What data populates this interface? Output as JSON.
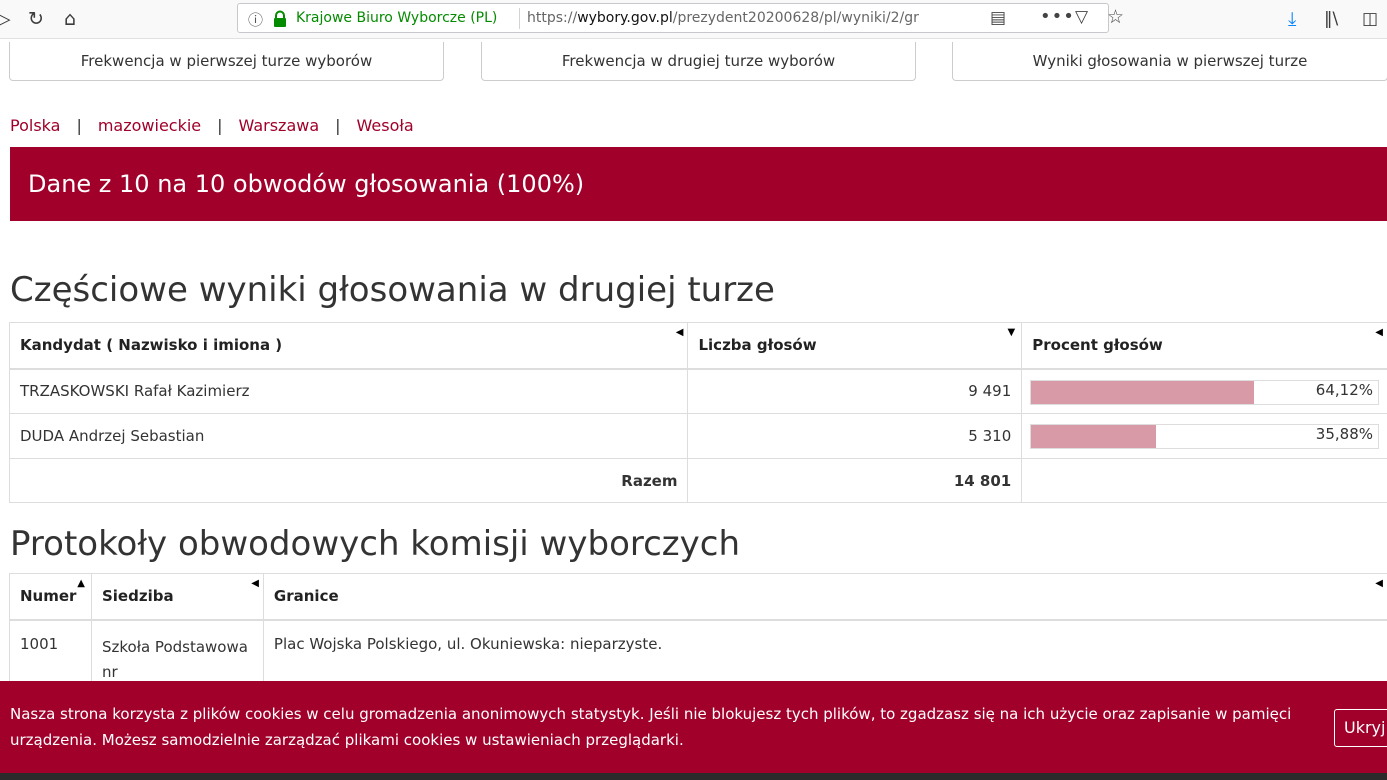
{
  "browser": {
    "url_org": "Krajowe Biuro Wyborcze (PL)",
    "url_prefix": "https://",
    "url_domain": "wybory.gov.pl",
    "url_path": "/prezydent20200628/pl/wyniki/2/gr"
  },
  "top_tabs": [
    "Frekwencja w pierwszej turze wyborów",
    "Frekwencja w drugiej turze wyborów",
    "Wyniki głosowania w pierwszej turze"
  ],
  "breadcrumb": [
    "Polska",
    "mazowieckie",
    "Warszawa",
    "Wesoła"
  ],
  "banner": "Dane z 10 na 10 obwodów głosowania (100%)",
  "results": {
    "heading": "Częściowe wyniki głosowania w drugiej turze",
    "columns": [
      "Kandydat ( Nazwisko i imiona )",
      "Liczba głosów",
      "Procent głosów"
    ],
    "rows": [
      {
        "name": "TRZASKOWSKI Rafał Kazimierz",
        "votes": "9 491",
        "percent": "64,12%",
        "fraction": 0.6412
      },
      {
        "name": "DUDA Andrzej Sebastian",
        "votes": "5 310",
        "percent": "35,88%",
        "fraction": 0.3588
      }
    ],
    "total_label": "Razem",
    "total_votes": "14 801"
  },
  "protocols": {
    "heading": "Protokoły obwodowych komisji wyborczych",
    "columns": [
      "Numer",
      "Siedziba",
      "Granice"
    ],
    "rows": [
      {
        "numer": "1001",
        "siedziba": "Szkoła Podstawowa nr",
        "granice": "Plac Wojska Polskiego, ul. Okuniewska: nieparzyste."
      }
    ]
  },
  "cookie": {
    "text": "Nasza strona korzysta z plików cookies w celu gromadzenia anonimowych statystyk. Jeśli nie blokujesz tych plików, to zgadzasz się na ich użycie oraz zapisanie w pamięci urządzenia. Możesz samodzielnie zarządzać plikami cookies w ustawieniach przeglądarki.",
    "button": "Ukryj"
  },
  "colors": {
    "brand": "#a0002a",
    "bar": "#d99aa8"
  }
}
